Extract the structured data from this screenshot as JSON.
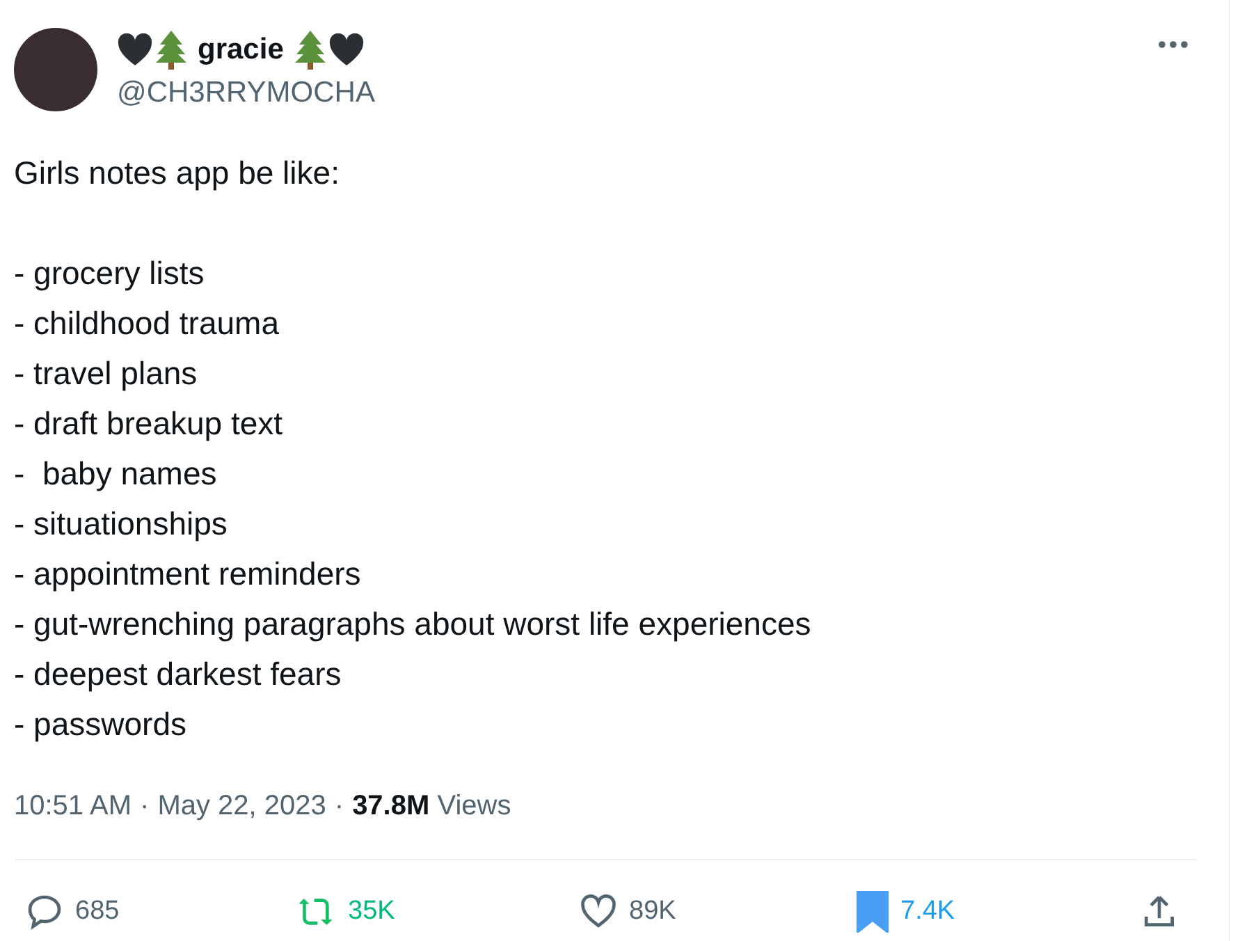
{
  "author": {
    "name": "gracie",
    "handle": "@CH3RRYMOCHA"
  },
  "intro": "Girls notes app be like:",
  "body": [
    "- grocery lists",
    "- childhood trauma",
    "- travel plans",
    "- draft breakup text",
    "-  baby names",
    "- situationships",
    "- appointment reminders",
    "- gut-wrenching paragraphs about worst life experiences",
    "- deepest darkest fears",
    "- passwords"
  ],
  "meta": {
    "separator": "·",
    "time": "10:51 AM",
    "date": "May 22, 2023",
    "views_count": "37.8M",
    "views_label": "Views"
  },
  "actions": [
    {
      "kind": "reply",
      "count": "685",
      "active": false
    },
    {
      "kind": "repost",
      "count": "35K",
      "active": true
    },
    {
      "kind": "like",
      "count": "89K",
      "active": false
    },
    {
      "kind": "bookmark",
      "count": "7.4K",
      "active": true
    },
    {
      "kind": "share",
      "active": false
    }
  ]
}
